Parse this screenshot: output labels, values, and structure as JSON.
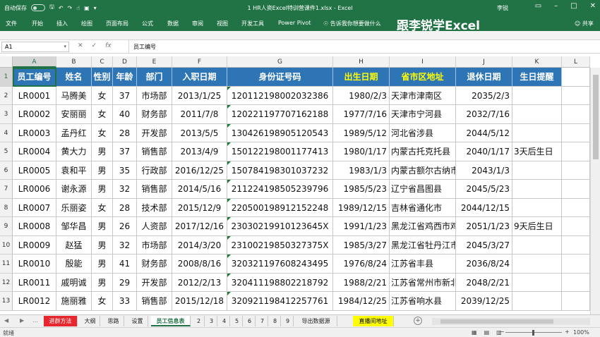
{
  "titlebar": {
    "autosave_label": "自动保存",
    "doc_title": "1 HR人资Excel特训营课件1.xlsx  -  Excel",
    "user": "李锐",
    "colors": {
      "bar": "#217346"
    }
  },
  "ribbon": {
    "tabs": [
      "文件",
      "开始",
      "插入",
      "绘图",
      "页面布局",
      "公式",
      "数据",
      "审阅",
      "视图",
      "开发工具",
      "Power Pivot"
    ],
    "tellme": "告诉我你想要做什么",
    "watermark": "跟李锐学Excel",
    "share": "共享"
  },
  "formulabar": {
    "namebox": "A1",
    "formula": "员工编号"
  },
  "columns": [
    "A",
    "B",
    "C",
    "D",
    "E",
    "F",
    "G",
    "H",
    "I",
    "J",
    "K",
    "L"
  ],
  "rows": [
    "1",
    "2",
    "3",
    "4",
    "5",
    "6",
    "7",
    "8",
    "9",
    "10",
    "11",
    "12",
    "13"
  ],
  "table": {
    "headers": [
      "员工编号",
      "姓名",
      "性别",
      "年龄",
      "部门",
      "入职日期",
      "身份证号码",
      "出生日期",
      "省市区地址",
      "退休日期",
      "生日提醒"
    ],
    "data": [
      [
        "LR0001",
        "马腾美",
        "女",
        "37",
        "市场部",
        "2013/1/25",
        "120112198002032386",
        "1980/2/3",
        "天津市津南区",
        "2035/2/3",
        ""
      ],
      [
        "LR0002",
        "安丽丽",
        "女",
        "40",
        "财务部",
        "2011/7/8",
        "120221197707162188",
        "1977/7/16",
        "天津市宁河县",
        "2032/7/16",
        ""
      ],
      [
        "LR0003",
        "孟丹红",
        "女",
        "28",
        "开发部",
        "2013/5/5",
        "130426198905120543",
        "1989/5/12",
        "河北省涉县",
        "2044/5/12",
        ""
      ],
      [
        "LR0004",
        "黄大力",
        "男",
        "37",
        "销售部",
        "2013/4/9",
        "150122198001177413",
        "1980/1/17",
        "内蒙古托克托县",
        "2040/1/17",
        "3天后生日"
      ],
      [
        "LR0005",
        "袁和平",
        "男",
        "35",
        "行政部",
        "2016/12/25",
        "150784198301037232",
        "1983/1/3",
        "内蒙古额尔古纳市",
        "2043/1/3",
        ""
      ],
      [
        "LR0006",
        "谢永源",
        "男",
        "32",
        "销售部",
        "2014/5/16",
        "211224198505239796",
        "1985/5/23",
        "辽宁省昌图县",
        "2045/5/23",
        ""
      ],
      [
        "LR0007",
        "乐丽姿",
        "女",
        "28",
        "技术部",
        "2015/12/9",
        "220500198912152248",
        "1989/12/15",
        "吉林省通化市",
        "2044/12/15",
        ""
      ],
      [
        "LR0008",
        "邹华昌",
        "男",
        "26",
        "人资部",
        "2017/12/16",
        "23030219910123645X",
        "1991/1/23",
        "黑龙江省鸡西市鸡冠区",
        "2051/1/23",
        "9天后生日"
      ],
      [
        "LR0009",
        "赵猛",
        "男",
        "32",
        "市场部",
        "2014/3/20",
        "23100219850327375X",
        "1985/3/27",
        "黑龙江省牡丹江市",
        "2045/3/27",
        ""
      ],
      [
        "LR0010",
        "殷能",
        "男",
        "41",
        "财务部",
        "2008/8/16",
        "320321197608243495",
        "1976/8/24",
        "江苏省丰县",
        "2036/8/24",
        ""
      ],
      [
        "LR0011",
        "戚明诚",
        "男",
        "29",
        "开发部",
        "2012/2/13",
        "320411198802218792",
        "1988/2/21",
        "江苏省常州市新北区",
        "2048/2/21",
        ""
      ],
      [
        "LR0012",
        "施丽雅",
        "女",
        "33",
        "销售部",
        "2015/12/18",
        "320921198412257761",
        "1984/12/25",
        "江苏省响水县",
        "2039/12/25",
        ""
      ]
    ],
    "colors": {
      "header_bg": "#2e75b6",
      "header_text": "#ffffff",
      "header_highlight": "#ffff00"
    }
  },
  "sheettabs": {
    "tabs": [
      "进群方法",
      "大纲",
      "思路",
      "设置",
      "员工信息表",
      "2",
      "3",
      "4",
      "5",
      "6",
      "7",
      "8",
      "9",
      "导出数据源",
      "直播间地址"
    ],
    "active": "员工信息表"
  },
  "statusbar": {
    "ready": "就绪",
    "zoom": "100%"
  }
}
